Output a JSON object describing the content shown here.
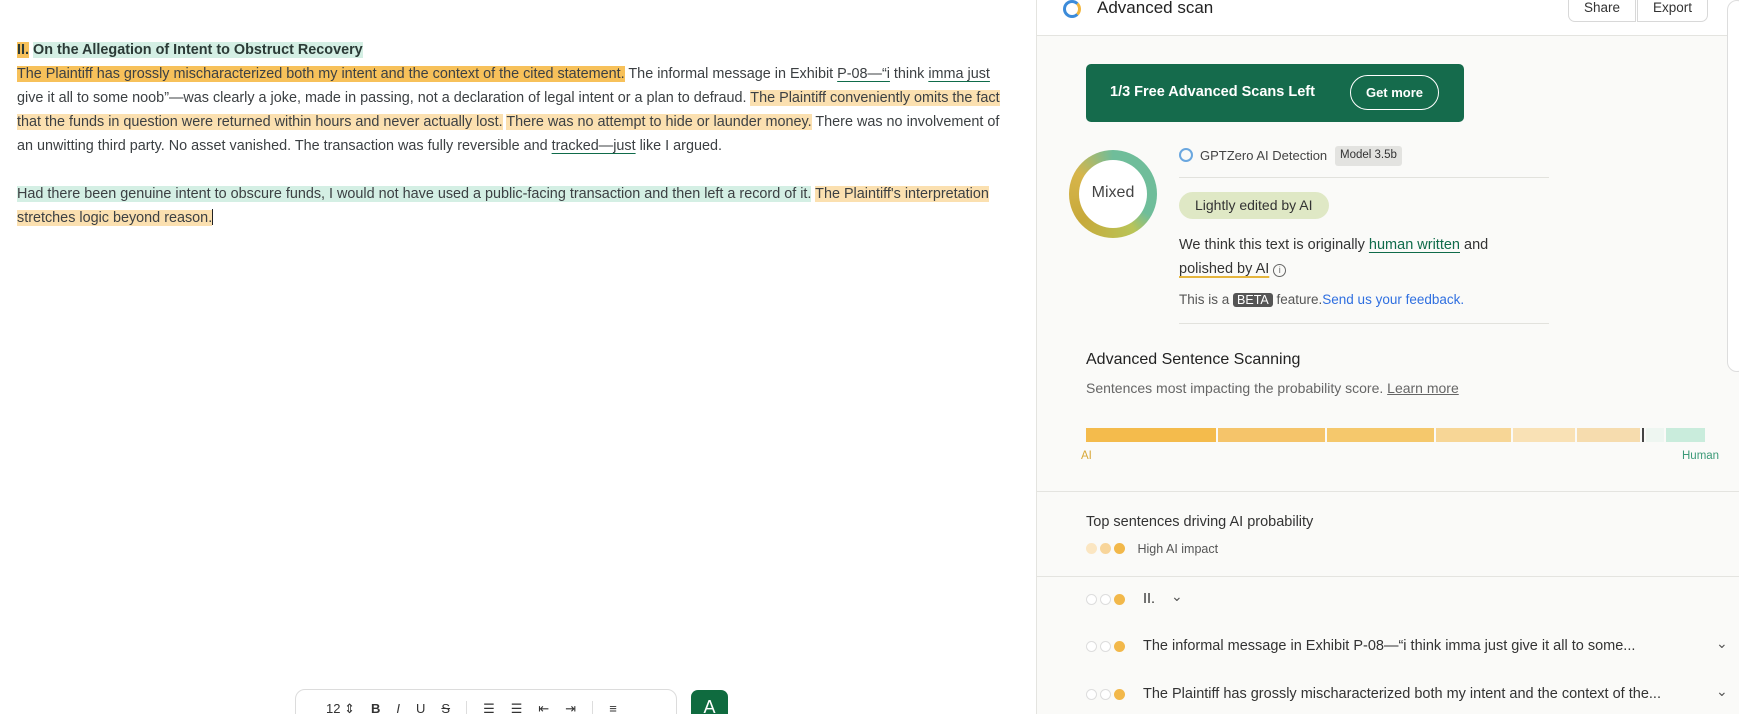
{
  "editor": {
    "heading_num": "II.",
    "heading_text": "On the Allegation of Intent to Obstruct Recovery",
    "p1": {
      "s1": "The Plaintiff has grossly mischaracterized both my intent and the context of the cited statement.",
      "s2a": " The informal message in Exhibit ",
      "s2b": "P-08—“i",
      "s2c": " think ",
      "s2d": "imma just",
      "s2e": " give it all to some noob”—was clearly a joke, made in passing, not a declaration of legal intent or a plan to defraud. ",
      "s3": "The Plaintiff conveniently omits the fact that the funds in question were returned within hours and never actually lost.",
      "s4": "There was no attempt to hide or launder money.",
      "s5a": " There was no involvement of an unwitting third party. No asset vanished. The transaction was fully reversible and ",
      "s5b": "tracked—just",
      "s5c": " like I argued."
    },
    "p2": {
      "s1": "Had there been genuine intent to obscure funds, I would not have used a public-facing transaction and then left a record of it.",
      "s2": "The Plaintiff's interpretation stretches logic beyond reason."
    },
    "toolbar": {
      "font_size": "12",
      "bold": "B",
      "italic": "I",
      "underline": "U",
      "strike": "S",
      "fab": "A"
    }
  },
  "panel": {
    "title": "Advanced scan",
    "share": "Share",
    "export": "Export",
    "banner_text": "1/3 Free Advanced Scans Left",
    "banner_button": "Get more",
    "ring_label": "Mixed",
    "detector_label": "GPTZero AI Detection",
    "model_badge": "Model 3.5b",
    "verdict": "Lightly edited by AI",
    "explain_a": "We think this text is originally ",
    "explain_b": "human written",
    "explain_c": " and ",
    "explain_d": "polished by AI",
    "beta_a": "This is a ",
    "beta_badge": "BETA",
    "beta_b": " feature.",
    "feedback": "Send us your feedback.",
    "section_title": "Advanced Sentence Scanning",
    "section_sub": "Sentences most impacting the probability score. ",
    "learn_more": "Learn more",
    "bar_ai": "AI",
    "bar_human": "Human",
    "top_title": "Top sentences driving AI probability",
    "legend_label": "High AI impact",
    "rows": [
      "II.",
      "The informal message in Exhibit P-08—“i think imma just give it all to some...",
      "The Plaintiff has grossly mischaracterized both my intent and the context of the..."
    ]
  },
  "colors": {
    "ai_strong": "#f7c15a",
    "ai_light": "#fbe0b0",
    "human": "#d4efe4",
    "brand_green": "#156b4c"
  }
}
